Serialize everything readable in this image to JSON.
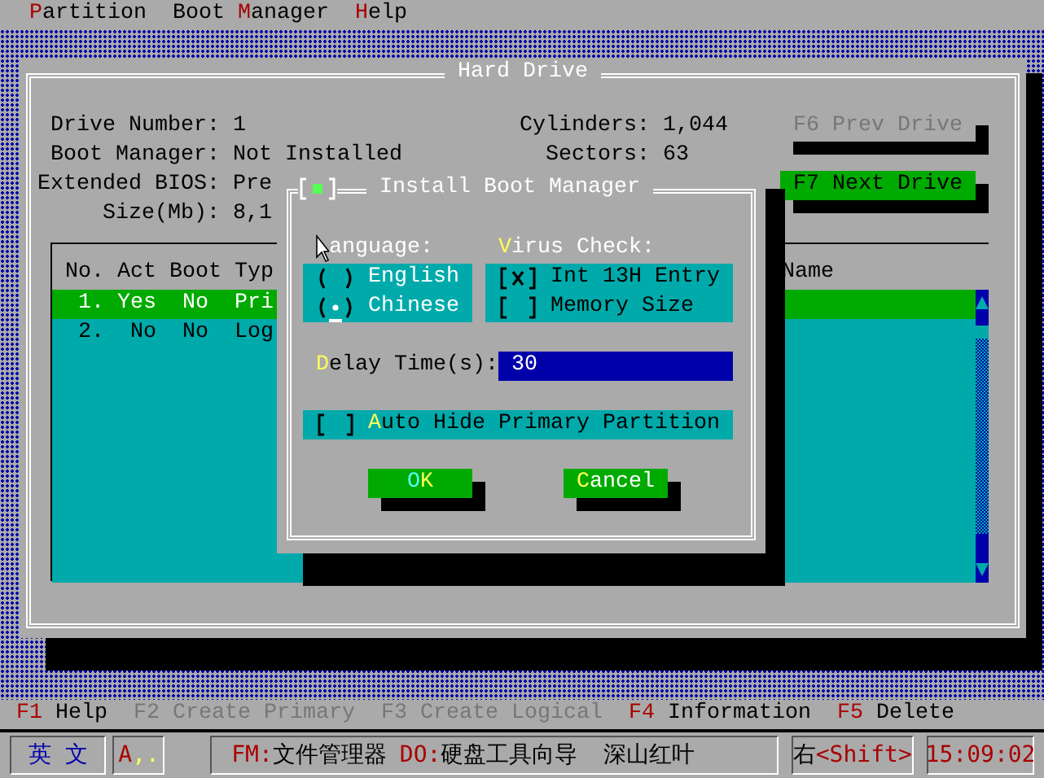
{
  "menu_bar": [
    {
      "key": "P",
      "rest": "artition"
    },
    {
      "pre": "Boot ",
      "key": "M",
      "rest": "anager"
    },
    {
      "key": "H",
      "rest": "elp"
    }
  ],
  "window": {
    "title": "Hard Drive",
    "info_left": [
      {
        "label": "Drive Number:",
        "value": "1"
      },
      {
        "label": "Boot Manager:",
        "value": "Not Installed"
      },
      {
        "label": "Extended BIOS:",
        "value": "Pre"
      },
      {
        "label": "Size(Mb):",
        "value": "8,1"
      }
    ],
    "info_right": [
      {
        "label": "Cylinders:",
        "value": "1,044"
      },
      {
        "label": "Sectors:",
        "value": "63"
      }
    ],
    "buttons": [
      {
        "label": "F6 Prev Drive",
        "disabled": true
      },
      {
        "label": "F7 Next Drive",
        "disabled": false
      }
    ],
    "partition_table": {
      "columns": [
        "No.",
        "Act",
        "Boot",
        "Typ",
        "Name"
      ],
      "rows": [
        {
          "cells": [
            "1.",
            "Yes",
            "No",
            "Pri"
          ],
          "selected": true
        },
        {
          "cells": [
            "2.",
            "No",
            "No",
            "Log"
          ],
          "selected": false
        }
      ]
    }
  },
  "dialog": {
    "title": "Install Boot Manager",
    "language": {
      "label": "anguage:",
      "options": [
        {
          "label": "English",
          "selected": false
        },
        {
          "label": "Chinese",
          "selected": true
        }
      ]
    },
    "virus_check": {
      "key": "V",
      "rest": "irus Check:",
      "options": [
        {
          "label": "Int 13H Entry",
          "checked": true
        },
        {
          "label": "Memory Size",
          "checked": false
        }
      ]
    },
    "delay": {
      "key": "D",
      "rest": "elay Time(s):",
      "value": "30"
    },
    "auto_hide": {
      "key": "A",
      "rest": "uto Hide Primary Partition",
      "checked": false
    },
    "buttons": [
      {
        "key": "O",
        "rest": "K",
        "focused": true
      },
      {
        "key": "C",
        "rest": "ancel",
        "focused": false
      }
    ]
  },
  "function_keys": [
    {
      "key": "F1",
      "label": "Help",
      "disabled": false
    },
    {
      "key": "F2",
      "label": "Create Primary",
      "disabled": true
    },
    {
      "key": "F3",
      "label": "Create Logical",
      "disabled": true
    },
    {
      "key": "F4",
      "label": "Information",
      "disabled": false
    },
    {
      "key": "F5",
      "label": "Delete",
      "disabled": false
    }
  ],
  "status_bar": {
    "input_mode": "英 文",
    "indicator": {
      "key": "A",
      "rest": ",."
    },
    "hints": [
      {
        "key": "FM:",
        "label": "文件管理器"
      },
      {
        "key": "DO:",
        "label": "硬盘工具向导"
      }
    ],
    "extra": "深山红叶",
    "shift": {
      "pre": "右",
      "key": "<Shift>"
    },
    "time": "15:09:02"
  }
}
